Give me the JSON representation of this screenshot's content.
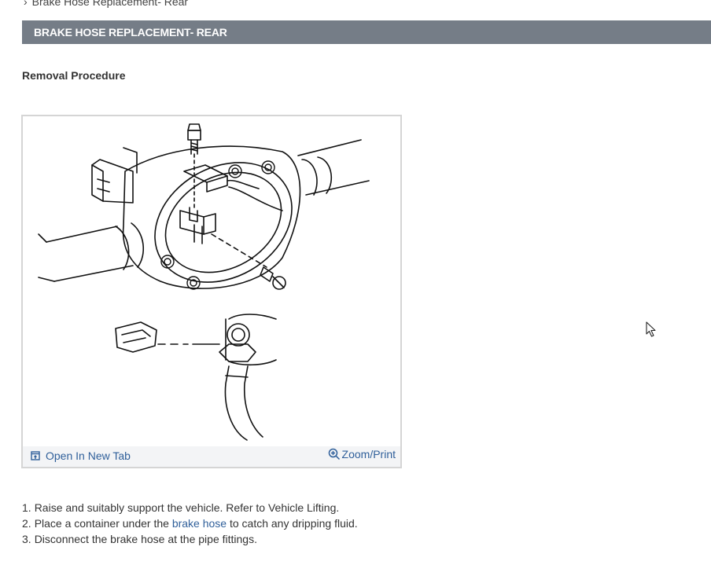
{
  "breadcrumb": {
    "current": "Brake Hose Replacement- Rear"
  },
  "section": {
    "title": "BRAKE HOSE REPLACEMENT- REAR"
  },
  "procedure": {
    "heading": "Removal Procedure"
  },
  "figure": {
    "open_tab_label": "Open In New Tab",
    "zoom_label": "Zoom/Print"
  },
  "steps": [
    {
      "num": "1.",
      "text": "Raise and suitably support the vehicle. Refer to Vehicle Lifting."
    },
    {
      "num": "2.",
      "pre": "Place a container under the ",
      "link": "brake hose",
      "post": " to catch any dripping fluid."
    },
    {
      "num": "3.",
      "text": "Disconnect the brake hose at the pipe fittings."
    }
  ],
  "colors": {
    "section_bar": "#757d87",
    "link": "#2f5f9a",
    "figure_border": "#d5d5d5",
    "figure_bar": "#f3f4f6"
  },
  "icons": {
    "breadcrumb": "chevron-right-icon",
    "open_tab": "open-new-tab-icon",
    "zoom": "zoom-in-icon",
    "cursor": "mouse-pointer-icon"
  }
}
